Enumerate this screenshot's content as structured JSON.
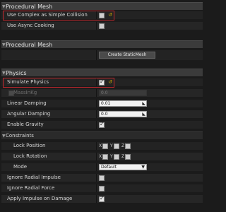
{
  "sections": {
    "procedural_mesh_1": {
      "title": "Procedural Mesh"
    },
    "procedural_mesh_2": {
      "title": "Procedural Mesh"
    },
    "physics": {
      "title": "Physics"
    }
  },
  "procedural_mesh_1": {
    "use_complex_as_simple_collision": {
      "label": "Use Complex as Simple Collision",
      "checked": false
    },
    "use_async_cooking": {
      "label": "Use Async Cooking",
      "checked": false
    }
  },
  "procedural_mesh_2": {
    "create_static_mesh_label": "Create StaticMesh"
  },
  "physics": {
    "simulate_physics": {
      "label": "Simulate Physics",
      "checked": true
    },
    "mass_in_kg": {
      "label": "MassInKg",
      "value": "0.0"
    },
    "linear_damping": {
      "label": "Linear Damping",
      "value": "0.01"
    },
    "angular_damping": {
      "label": "Angular Damping",
      "value": "0.0"
    },
    "enable_gravity": {
      "label": "Enable Gravity",
      "checked": true
    },
    "constraints": {
      "title": "Constraints",
      "lock_position": {
        "label": "Lock Position",
        "x": "X",
        "y": "Y",
        "z": "Z"
      },
      "lock_rotation": {
        "label": "Lock Rotation",
        "x": "X",
        "y": "Y",
        "z": "Z"
      },
      "mode": {
        "label": "Mode",
        "value": "Default"
      }
    },
    "ignore_radial_impulse": {
      "label": "Ignore Radial Impulse",
      "checked": false
    },
    "ignore_radial_force": {
      "label": "Ignore Radial Force",
      "checked": false
    },
    "apply_impulse_on_damage": {
      "label": "Apply Impulse on Damage",
      "checked": true
    }
  },
  "icons": {
    "collapse": "triangle-down-icon",
    "reset": "reset-to-default-icon",
    "spin": "spinner-icon",
    "caret": "chevron-down-icon"
  },
  "colors": {
    "highlight": "#c0282e",
    "reset_arrow": "#d8b200"
  }
}
